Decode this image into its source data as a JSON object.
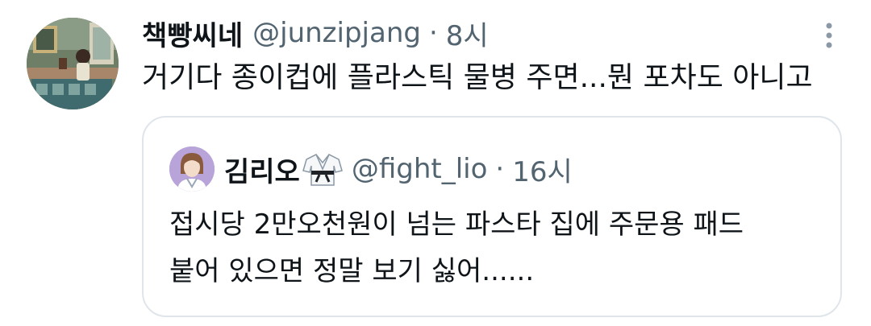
{
  "tweet": {
    "display_name": "책빵씨네",
    "handle": "@junzipjang",
    "separator": "·",
    "time": "8시",
    "text": "거기다 종이컵에 플라스틱 물병 주면...뭔 포차도 아니고",
    "avatar_icon": "illustrated-room-avatar",
    "more_icon": "more-vertical-icon"
  },
  "quote": {
    "display_name": "김리오",
    "name_emoji": "martial-arts-uniform-emoji",
    "handle": "@fight_lio",
    "separator": "·",
    "time": "16시",
    "text_line1": "접시당 2만오천원이 넘는 파스타 집에 주문용 패드",
    "text_line2": "붙어 있으면 정말 보기 싫어......",
    "avatar_icon": "anime-character-avatar"
  },
  "colors": {
    "text_primary": "#0f1419",
    "text_secondary": "#536471",
    "border": "#dfe5ea",
    "background": "#ffffff"
  }
}
